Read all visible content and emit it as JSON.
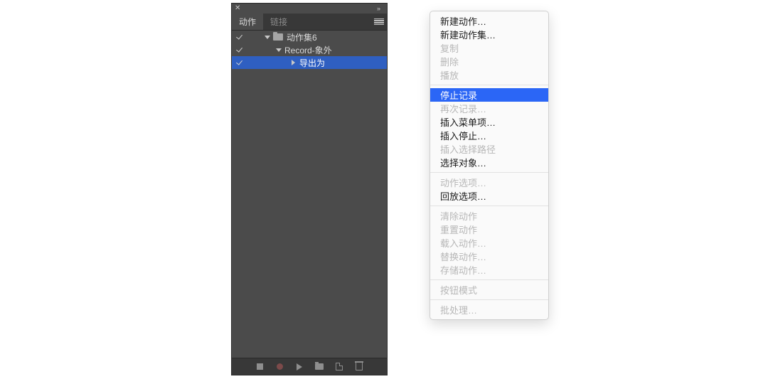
{
  "panel": {
    "tabs": {
      "actions": "动作",
      "links": "链接"
    },
    "tree": {
      "set": {
        "label": "动作集6"
      },
      "action": {
        "label": "Record-象外"
      },
      "step": {
        "label": "导出为"
      }
    }
  },
  "menu": {
    "g1": {
      "new_action": "新建动作…",
      "new_set": "新建动作集…",
      "duplicate": "复制",
      "delete": "删除",
      "play": "播放"
    },
    "g2": {
      "stop_rec": "停止记录",
      "rerecord": "再次记录…",
      "insert_menu": "插入菜单项…",
      "insert_stop": "插入停止…",
      "insert_path": "插入选择路径",
      "select_obj": "选择对象…"
    },
    "g3": {
      "action_opts": "动作选项…",
      "playback_opts": "回放选项…"
    },
    "g4": {
      "clear": "清除动作",
      "reset": "重置动作",
      "load": "载入动作…",
      "replace": "替换动作…",
      "save": "存储动作…"
    },
    "g5": {
      "button_mode": "按钮模式"
    },
    "g6": {
      "batch": "批处理…"
    }
  }
}
